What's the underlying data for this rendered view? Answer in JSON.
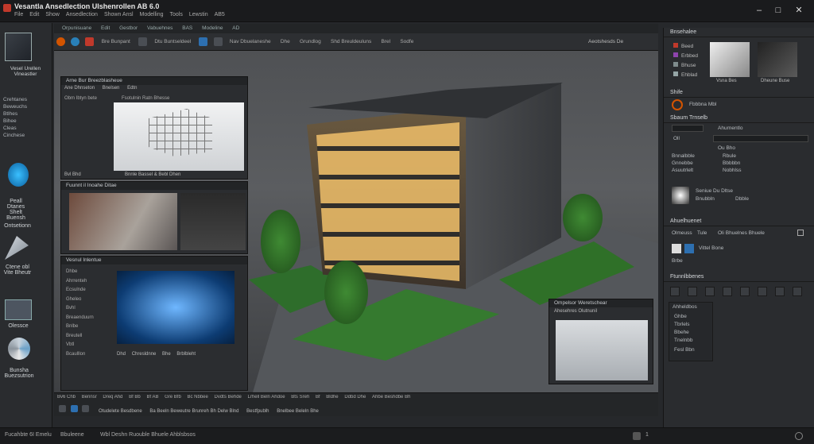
{
  "app": {
    "title": "Vesantla Ansedlection Ulshenrollen AB 6.0",
    "menu": [
      "File",
      "Edit",
      "Show",
      "Ansedlection",
      "Shown Ansl",
      "Modelling",
      "Tools",
      "Lewstin",
      "AB5"
    ]
  },
  "tabs": [
    "Orpunisuane",
    "Edit",
    "Gestbor",
    "Vabuehnes",
    "BAS",
    "Modeline",
    "AD"
  ],
  "toolbar": {
    "labels": [
      "Bre Bunpant",
      "Dtu Buntseldeel",
      "Nav Dbuelaneshe",
      "Dhe",
      "Grundlog",
      "Shd Breuldeuluns",
      "Brel",
      "Sodfe"
    ],
    "right_label": "Aeotshesds De"
  },
  "left": {
    "tool1": "Vesel Urellen Vineastler",
    "list": [
      "Crehtanes",
      "Beweuchs",
      "Btlhes",
      "Bihee",
      "Cleas",
      "Cinchese"
    ],
    "tool2": "Peall Dtanes Shelt Buensh",
    "tool3": "Ontsetionn",
    "tool4": "Ctene obl Vite Bheutr",
    "tool5": "Olessce",
    "tool6": "Bunsha Buezsutrion"
  },
  "panels": {
    "p1_title": "Arne Bur Breezblasheue",
    "p1_tabs": [
      "Ane Dhnseton",
      "Bnelsen",
      "Edtn"
    ],
    "p1_sub": [
      "Obm Ibtyn bete",
      "Fsotulnin Ratn Bhesse"
    ],
    "p1_foot": [
      "Bvl Bhd",
      "Bnnle Bassel & Bebl Dhen"
    ],
    "p2_title": "Fuunnt il Inoahe Ditae",
    "p3_title": "Vesnul Inlentue",
    "p3_rows": [
      "Dhbe",
      "Ahrrenteh",
      "Ecsulnde",
      "Gheleo",
      "Bvhl",
      "Breaenduurn",
      "Bnlbe",
      "Breutell",
      "Vbtl",
      "Bcaulllon"
    ],
    "p3_foot": [
      "Dhd",
      "Chresldnne",
      "Bhe",
      "Brblbleht"
    ],
    "p4_title": "Ompelsor Weretschear",
    "p4_sub": "Ahesehres Olutnunil"
  },
  "right": {
    "h1": "Bnsehalee",
    "swatches": [
      "Beed",
      "Erbbed",
      "Bhuse",
      "Ehblad"
    ],
    "thumbs": [
      "Vsna Bes",
      "Dheune Buse"
    ],
    "h2": "Shife",
    "obj": "Fbbbna Mbl",
    "h3": "Sbaum Trnselb",
    "fields": [
      "Ahurnentlo",
      "Oll",
      "Ou Bho"
    ],
    "props": [
      "Bnnalbble",
      "Gnnebbe",
      "Asuutrlelt"
    ],
    "prop_vals": [
      "Rbule",
      "Bbbbbn",
      "Nobhlss"
    ],
    "light_title": "Seniue Du Dltse",
    "light_rows": [
      "Bnubbln",
      "Dbble"
    ],
    "h4": "Ahuelhuenet",
    "anim": [
      "Olmeuss",
      "Tule",
      "Oli Bhuelnes Bhuele"
    ],
    "mat": [
      "Vittel Bone",
      "Brbe"
    ],
    "h5": "Ftunnlbbenes",
    "h6": "Ahheldbos",
    "layers": [
      "Ghbe",
      "Tbrlels",
      "Bbehe",
      "Tnelnbb",
      "Fesl Bbn"
    ]
  },
  "bottom": {
    "row1": [
      "Bv6 Chb",
      "Bennsr",
      "Dreq Ahd",
      "Bf Bb",
      "Bf AB",
      "Gre Bfb",
      "Bc Nbbee",
      "Dvdts Behde",
      "Lrhell Beln Ahdoe",
      "Bts Sreh",
      "Bf",
      "Bldhe",
      "Ddbd Dhe",
      "Ahbe Beshdbe Bh"
    ],
    "row2": [
      "Otudelete Besdbene",
      "Ba Beeln Beweutre Brunreh Bh Delw Blnd",
      "Bestfpublh",
      "Bnelbee Beleln Bhe"
    ]
  },
  "status": {
    "left": "Fucahbte 6I Emelu",
    "mid": "Bbuleene",
    "right": "Wbl Deshn Ruouble Bhuele Ahblsbsos",
    "count": "1"
  }
}
